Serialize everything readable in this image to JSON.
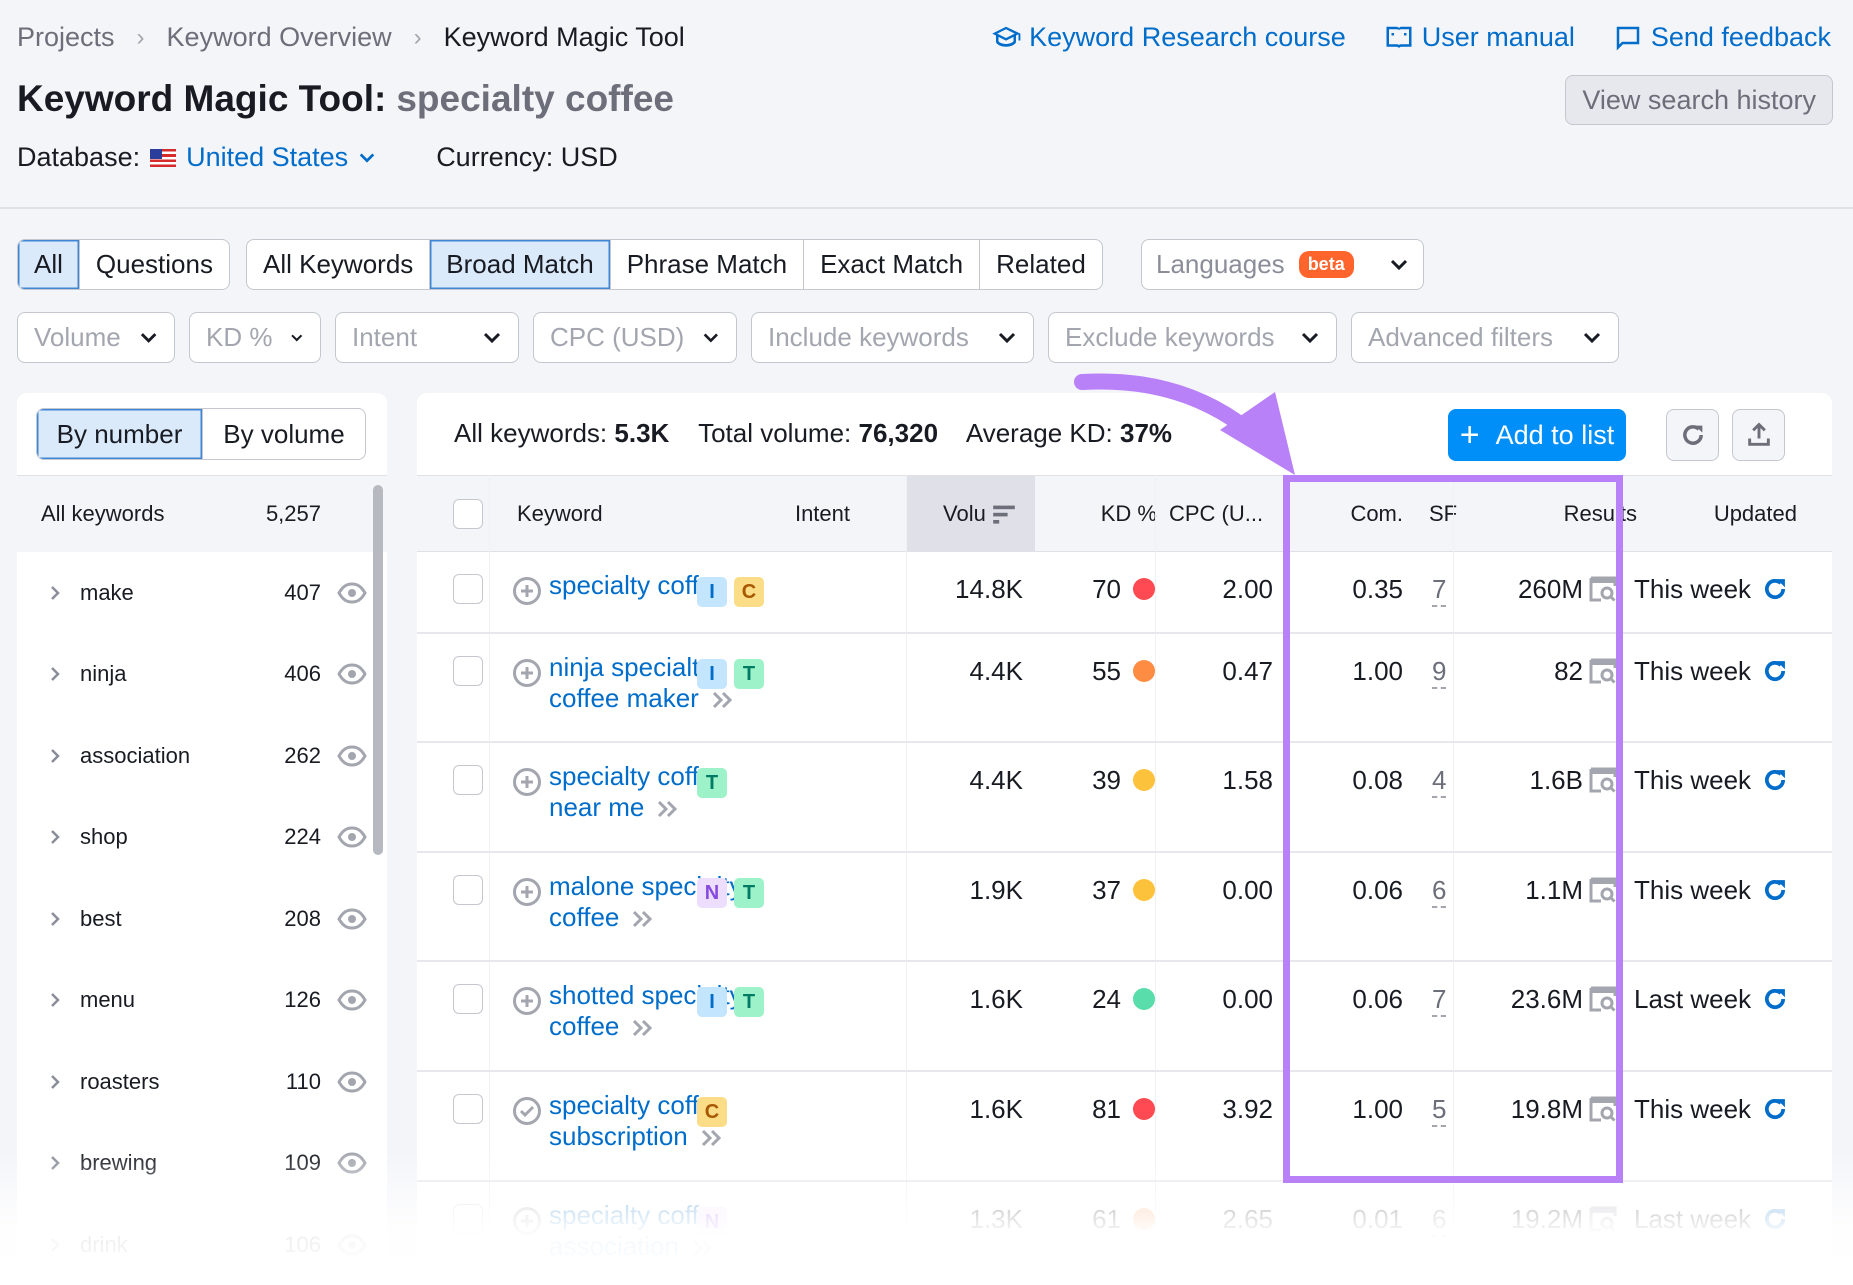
{
  "breadcrumb": [
    "Projects",
    "Keyword Overview",
    "Keyword Magic Tool"
  ],
  "top_links": [
    {
      "icon": "graduation-cap-icon",
      "label": "Keyword Research course"
    },
    {
      "icon": "book-icon",
      "label": "User manual"
    },
    {
      "icon": "chat-bubble-icon",
      "label": "Send feedback"
    }
  ],
  "title": {
    "tool": "Keyword Magic Tool:",
    "query": "specialty coffee"
  },
  "view_history_label": "View search history",
  "database": {
    "label": "Database:",
    "value": "United States",
    "flag": "us-flag-icon"
  },
  "currency": "Currency: USD",
  "tabs_type": [
    {
      "label": "All",
      "active": true
    },
    {
      "label": "Questions",
      "active": false
    }
  ],
  "tabs_match": [
    {
      "label": "All Keywords",
      "active": false
    },
    {
      "label": "Broad Match",
      "active": true
    },
    {
      "label": "Phrase Match",
      "active": false
    },
    {
      "label": "Exact Match",
      "active": false
    },
    {
      "label": "Related",
      "active": false
    }
  ],
  "languages": {
    "label": "Languages",
    "badge": "beta"
  },
  "filters": [
    "Volume",
    "KD %",
    "Intent",
    "CPC (USD)",
    "Include keywords",
    "Exclude keywords",
    "Advanced filters"
  ],
  "sidebar": {
    "toggle": [
      {
        "label": "By number",
        "active": true
      },
      {
        "label": "By volume",
        "active": false
      }
    ],
    "all": {
      "label": "All keywords",
      "count": "5,257"
    },
    "groups": [
      {
        "label": "make",
        "count": "407"
      },
      {
        "label": "ninja",
        "count": "406"
      },
      {
        "label": "association",
        "count": "262"
      },
      {
        "label": "shop",
        "count": "224"
      },
      {
        "label": "best",
        "count": "208"
      },
      {
        "label": "menu",
        "count": "126"
      },
      {
        "label": "roasters",
        "count": "110"
      },
      {
        "label": "brewing",
        "count": "109"
      },
      {
        "label": "drink",
        "count": "106"
      }
    ]
  },
  "stats": {
    "all_label": "All keywords:",
    "all_value": "5.3K",
    "vol_label": "Total volume:",
    "vol_value": "76,320",
    "kd_label": "Average KD:",
    "kd_value": "37%"
  },
  "add_to_list_label": "Add to list",
  "columns": [
    "Keyword",
    "Intent",
    "Volu",
    "KD %",
    "CPC (U...",
    "Com.",
    "SF",
    "Results",
    "Updated"
  ],
  "rows": [
    {
      "keyword": "specialty coffee",
      "added": false,
      "intent": [
        "I",
        "C"
      ],
      "volume": "14.8K",
      "kd": "70",
      "kd_color": "#ff4953",
      "cpc": "2.00",
      "com": "0.35",
      "sf": "7",
      "results": "260M",
      "updated": "This week"
    },
    {
      "keyword": "ninja specialty coffee maker",
      "added": false,
      "intent": [
        "I",
        "T"
      ],
      "volume": "4.4K",
      "kd": "55",
      "kd_color": "#ff8c43",
      "cpc": "0.47",
      "com": "1.00",
      "sf": "9",
      "results": "82",
      "updated": "This week"
    },
    {
      "keyword": "specialty coffee near me",
      "added": false,
      "intent": [
        "T"
      ],
      "volume": "4.4K",
      "kd": "39",
      "kd_color": "#fdc23c",
      "cpc": "1.58",
      "com": "0.08",
      "sf": "4",
      "results": "1.6B",
      "updated": "This week"
    },
    {
      "keyword": "malone specialty coffee",
      "added": false,
      "intent": [
        "N",
        "T"
      ],
      "volume": "1.9K",
      "kd": "37",
      "kd_color": "#fdc23c",
      "cpc": "0.00",
      "com": "0.06",
      "sf": "6",
      "results": "1.1M",
      "updated": "This week"
    },
    {
      "keyword": "shotted specialty coffee",
      "added": false,
      "intent": [
        "I",
        "T"
      ],
      "volume": "1.6K",
      "kd": "24",
      "kd_color": "#59ddaa",
      "cpc": "0.00",
      "com": "0.06",
      "sf": "7",
      "results": "23.6M",
      "updated": "Last week"
    },
    {
      "keyword": "specialty coffee subscription",
      "added": true,
      "intent": [
        "C"
      ],
      "volume": "1.6K",
      "kd": "81",
      "kd_color": "#ff4953",
      "cpc": "3.92",
      "com": "1.00",
      "sf": "5",
      "results": "19.8M",
      "updated": "This week"
    },
    {
      "keyword": "specialty coffee association",
      "added": false,
      "intent": [
        "N"
      ],
      "volume": "1.3K",
      "kd": "61",
      "kd_color": "#ffa36b",
      "cpc": "2.65",
      "com": "0.01",
      "sf": "6",
      "results": "19.2M",
      "updated": "Last week"
    }
  ],
  "colors": {
    "accent": "#006dca",
    "primary_button": "#008ff8",
    "highlight_box": "#b981f7",
    "beta_badge": "#ff642d"
  }
}
